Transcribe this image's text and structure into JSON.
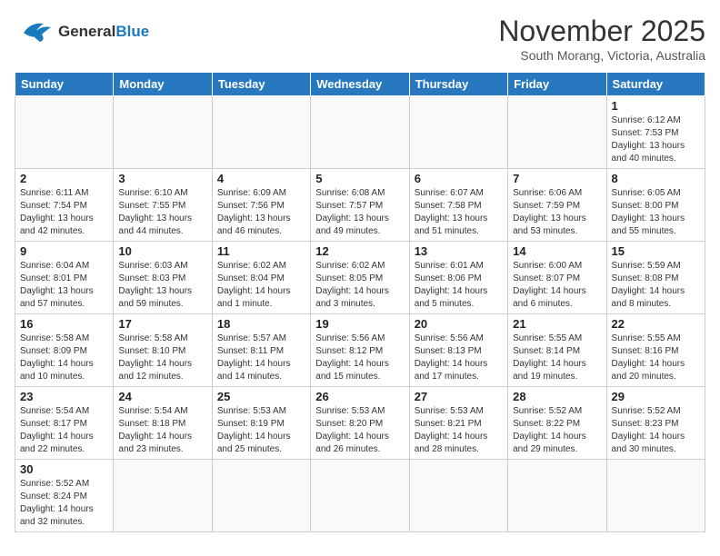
{
  "header": {
    "logo_general": "General",
    "logo_blue": "Blue",
    "month_title": "November 2025",
    "location": "South Morang, Victoria, Australia"
  },
  "weekdays": [
    "Sunday",
    "Monday",
    "Tuesday",
    "Wednesday",
    "Thursday",
    "Friday",
    "Saturday"
  ],
  "weeks": [
    [
      {
        "day": "",
        "data": ""
      },
      {
        "day": "",
        "data": ""
      },
      {
        "day": "",
        "data": ""
      },
      {
        "day": "",
        "data": ""
      },
      {
        "day": "",
        "data": ""
      },
      {
        "day": "",
        "data": ""
      },
      {
        "day": "1",
        "data": "Sunrise: 6:12 AM\nSunset: 7:53 PM\nDaylight: 13 hours\nand 40 minutes."
      }
    ],
    [
      {
        "day": "2",
        "data": "Sunrise: 6:11 AM\nSunset: 7:54 PM\nDaylight: 13 hours\nand 42 minutes."
      },
      {
        "day": "3",
        "data": "Sunrise: 6:10 AM\nSunset: 7:55 PM\nDaylight: 13 hours\nand 44 minutes."
      },
      {
        "day": "4",
        "data": "Sunrise: 6:09 AM\nSunset: 7:56 PM\nDaylight: 13 hours\nand 46 minutes."
      },
      {
        "day": "5",
        "data": "Sunrise: 6:08 AM\nSunset: 7:57 PM\nDaylight: 13 hours\nand 49 minutes."
      },
      {
        "day": "6",
        "data": "Sunrise: 6:07 AM\nSunset: 7:58 PM\nDaylight: 13 hours\nand 51 minutes."
      },
      {
        "day": "7",
        "data": "Sunrise: 6:06 AM\nSunset: 7:59 PM\nDaylight: 13 hours\nand 53 minutes."
      },
      {
        "day": "8",
        "data": "Sunrise: 6:05 AM\nSunset: 8:00 PM\nDaylight: 13 hours\nand 55 minutes."
      }
    ],
    [
      {
        "day": "9",
        "data": "Sunrise: 6:04 AM\nSunset: 8:01 PM\nDaylight: 13 hours\nand 57 minutes."
      },
      {
        "day": "10",
        "data": "Sunrise: 6:03 AM\nSunset: 8:03 PM\nDaylight: 13 hours\nand 59 minutes."
      },
      {
        "day": "11",
        "data": "Sunrise: 6:02 AM\nSunset: 8:04 PM\nDaylight: 14 hours\nand 1 minute."
      },
      {
        "day": "12",
        "data": "Sunrise: 6:02 AM\nSunset: 8:05 PM\nDaylight: 14 hours\nand 3 minutes."
      },
      {
        "day": "13",
        "data": "Sunrise: 6:01 AM\nSunset: 8:06 PM\nDaylight: 14 hours\nand 5 minutes."
      },
      {
        "day": "14",
        "data": "Sunrise: 6:00 AM\nSunset: 8:07 PM\nDaylight: 14 hours\nand 6 minutes."
      },
      {
        "day": "15",
        "data": "Sunrise: 5:59 AM\nSunset: 8:08 PM\nDaylight: 14 hours\nand 8 minutes."
      }
    ],
    [
      {
        "day": "16",
        "data": "Sunrise: 5:58 AM\nSunset: 8:09 PM\nDaylight: 14 hours\nand 10 minutes."
      },
      {
        "day": "17",
        "data": "Sunrise: 5:58 AM\nSunset: 8:10 PM\nDaylight: 14 hours\nand 12 minutes."
      },
      {
        "day": "18",
        "data": "Sunrise: 5:57 AM\nSunset: 8:11 PM\nDaylight: 14 hours\nand 14 minutes."
      },
      {
        "day": "19",
        "data": "Sunrise: 5:56 AM\nSunset: 8:12 PM\nDaylight: 14 hours\nand 15 minutes."
      },
      {
        "day": "20",
        "data": "Sunrise: 5:56 AM\nSunset: 8:13 PM\nDaylight: 14 hours\nand 17 minutes."
      },
      {
        "day": "21",
        "data": "Sunrise: 5:55 AM\nSunset: 8:14 PM\nDaylight: 14 hours\nand 19 minutes."
      },
      {
        "day": "22",
        "data": "Sunrise: 5:55 AM\nSunset: 8:16 PM\nDaylight: 14 hours\nand 20 minutes."
      }
    ],
    [
      {
        "day": "23",
        "data": "Sunrise: 5:54 AM\nSunset: 8:17 PM\nDaylight: 14 hours\nand 22 minutes."
      },
      {
        "day": "24",
        "data": "Sunrise: 5:54 AM\nSunset: 8:18 PM\nDaylight: 14 hours\nand 23 minutes."
      },
      {
        "day": "25",
        "data": "Sunrise: 5:53 AM\nSunset: 8:19 PM\nDaylight: 14 hours\nand 25 minutes."
      },
      {
        "day": "26",
        "data": "Sunrise: 5:53 AM\nSunset: 8:20 PM\nDaylight: 14 hours\nand 26 minutes."
      },
      {
        "day": "27",
        "data": "Sunrise: 5:53 AM\nSunset: 8:21 PM\nDaylight: 14 hours\nand 28 minutes."
      },
      {
        "day": "28",
        "data": "Sunrise: 5:52 AM\nSunset: 8:22 PM\nDaylight: 14 hours\nand 29 minutes."
      },
      {
        "day": "29",
        "data": "Sunrise: 5:52 AM\nSunset: 8:23 PM\nDaylight: 14 hours\nand 30 minutes."
      }
    ],
    [
      {
        "day": "30",
        "data": "Sunrise: 5:52 AM\nSunset: 8:24 PM\nDaylight: 14 hours\nand 32 minutes."
      },
      {
        "day": "",
        "data": ""
      },
      {
        "day": "",
        "data": ""
      },
      {
        "day": "",
        "data": ""
      },
      {
        "day": "",
        "data": ""
      },
      {
        "day": "",
        "data": ""
      },
      {
        "day": "",
        "data": ""
      }
    ]
  ]
}
